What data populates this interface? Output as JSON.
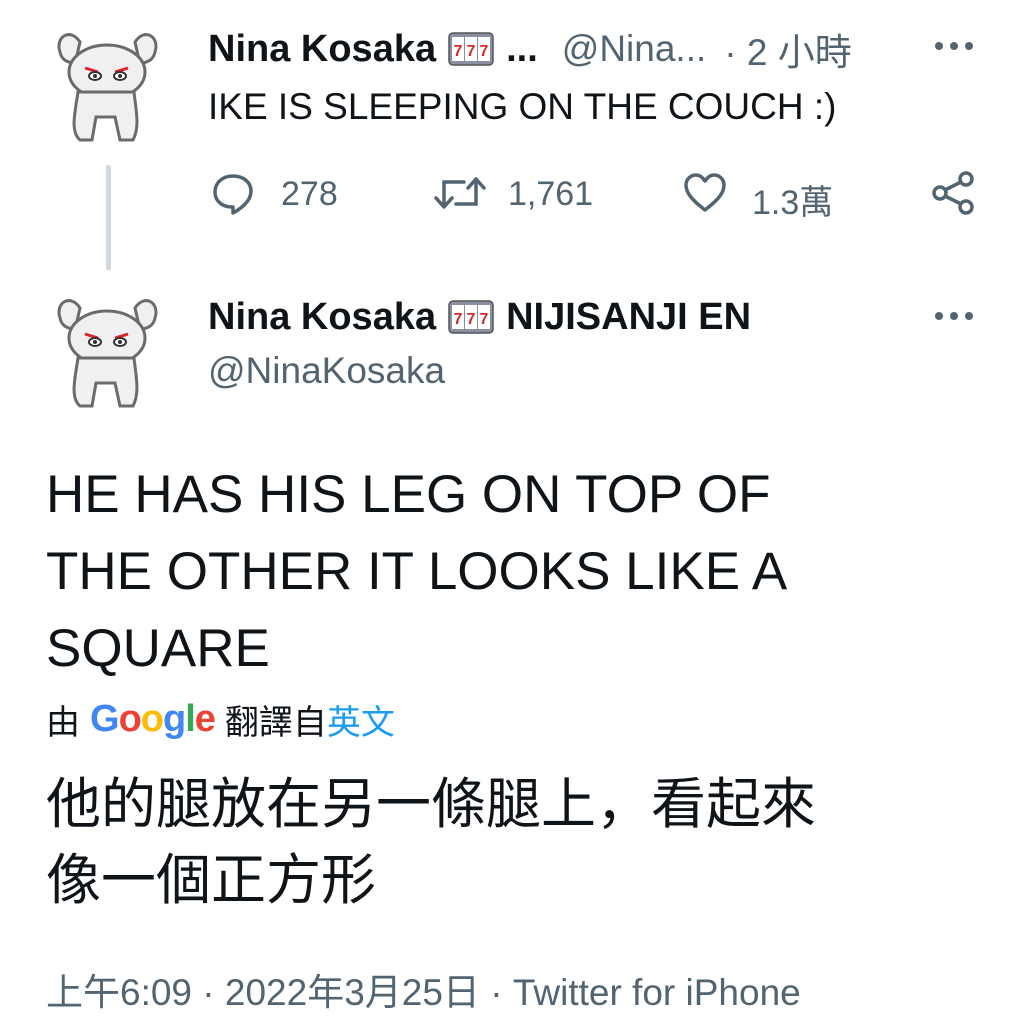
{
  "reply_tweet": {
    "display_name": "Nina Kosaka",
    "slot_icon": "slot-machine-777-icon",
    "name_ellipsis": "...",
    "handle": "@Nina...",
    "time": "· 2 小時",
    "more_icon": "more-horizontal-icon",
    "text": "IKE IS SLEEPING ON THE COUCH :)",
    "actions": {
      "reply_count": "278",
      "retweet_count": "1,761",
      "like_count": "1.3萬"
    }
  },
  "main_tweet": {
    "display_name": "Nina Kosaka",
    "name_suffix": "NIJISANJI EN",
    "handle": "@NinaKosaka",
    "text_lines": [
      "HE HAS HIS LEG ON TOP OF",
      "THE OTHER IT LOOKS LIKE A",
      "SQUARE"
    ],
    "translation_prefix": "由",
    "translation_brand": "Google",
    "translation_mid": "翻譯自",
    "translation_lang": "英文",
    "translated_lines": [
      "他的腿放在另一條腿上，看起來",
      "像一個正方形"
    ],
    "meta": "上午6:09 · 2022年3月25日 · Twitter for iPhone"
  },
  "colors": {
    "text": "#0f1419",
    "muted": "#536471",
    "link": "#1d9bf0",
    "thread_line": "#cfd9de"
  }
}
